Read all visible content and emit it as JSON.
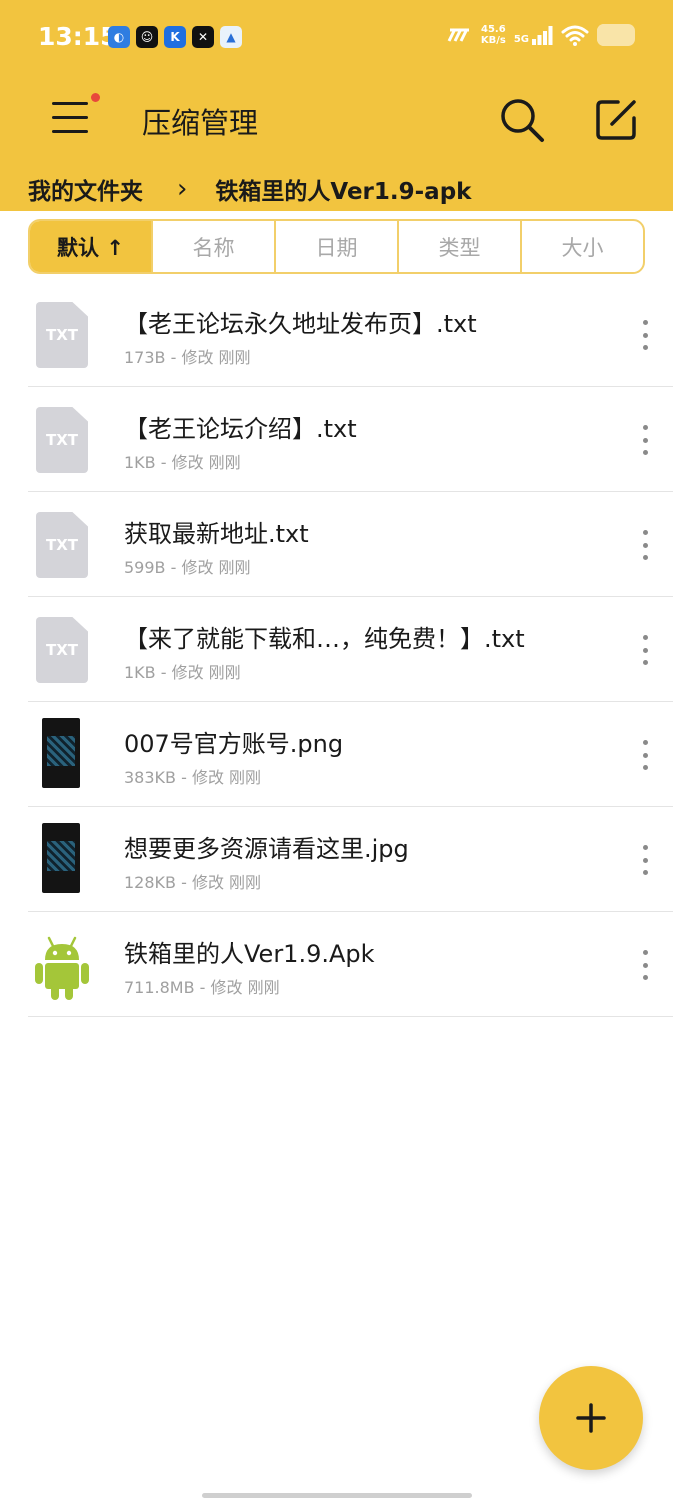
{
  "status_bar": {
    "time": "13:15",
    "net_speed_value": "45.6",
    "net_speed_unit": "KB/s",
    "network_type": "5G",
    "app_icons": [
      "app-icon-1",
      "app-icon-2",
      "app-icon-3",
      "app-icon-4",
      "app-icon-5"
    ],
    "battery_level": 0.6
  },
  "appbar": {
    "title": "压缩管理"
  },
  "breadcrumb": {
    "root": "我的文件夹",
    "current": "铁箱里的人Ver1.9-apk"
  },
  "sort_tabs": [
    {
      "label": "默认 ↑",
      "active": true
    },
    {
      "label": "名称",
      "active": false
    },
    {
      "label": "日期",
      "active": false
    },
    {
      "label": "类型",
      "active": false
    },
    {
      "label": "大小",
      "active": false
    }
  ],
  "files": [
    {
      "icon": "txt-file-icon",
      "icon_label": "TXT",
      "name": "【老王论坛永久地址发布页】.txt",
      "meta": "173B - 修改 刚刚"
    },
    {
      "icon": "txt-file-icon",
      "icon_label": "TXT",
      "name": "【老王论坛介绍】.txt",
      "meta": "1KB - 修改 刚刚"
    },
    {
      "icon": "txt-file-icon",
      "icon_label": "TXT",
      "name": "获取最新地址.txt",
      "meta": "599B - 修改 刚刚"
    },
    {
      "icon": "txt-file-icon",
      "icon_label": "TXT",
      "name": "【来了就能下载和…，纯免费！】.txt",
      "meta": "1KB - 修改 刚刚"
    },
    {
      "icon": "image-thumbnail-icon",
      "icon_label": "",
      "name": "007号官方账号.png",
      "meta": "383KB - 修改 刚刚"
    },
    {
      "icon": "image-thumbnail-icon",
      "icon_label": "",
      "name": "想要更多资源请看这里.jpg",
      "meta": "128KB - 修改 刚刚"
    },
    {
      "icon": "android-apk-icon",
      "icon_label": "",
      "name": "铁箱里的人Ver1.9.Apk",
      "meta": "711.8MB - 修改 刚刚"
    }
  ],
  "colors": {
    "accent": "#f2c43f",
    "android_green": "#a4c639"
  }
}
